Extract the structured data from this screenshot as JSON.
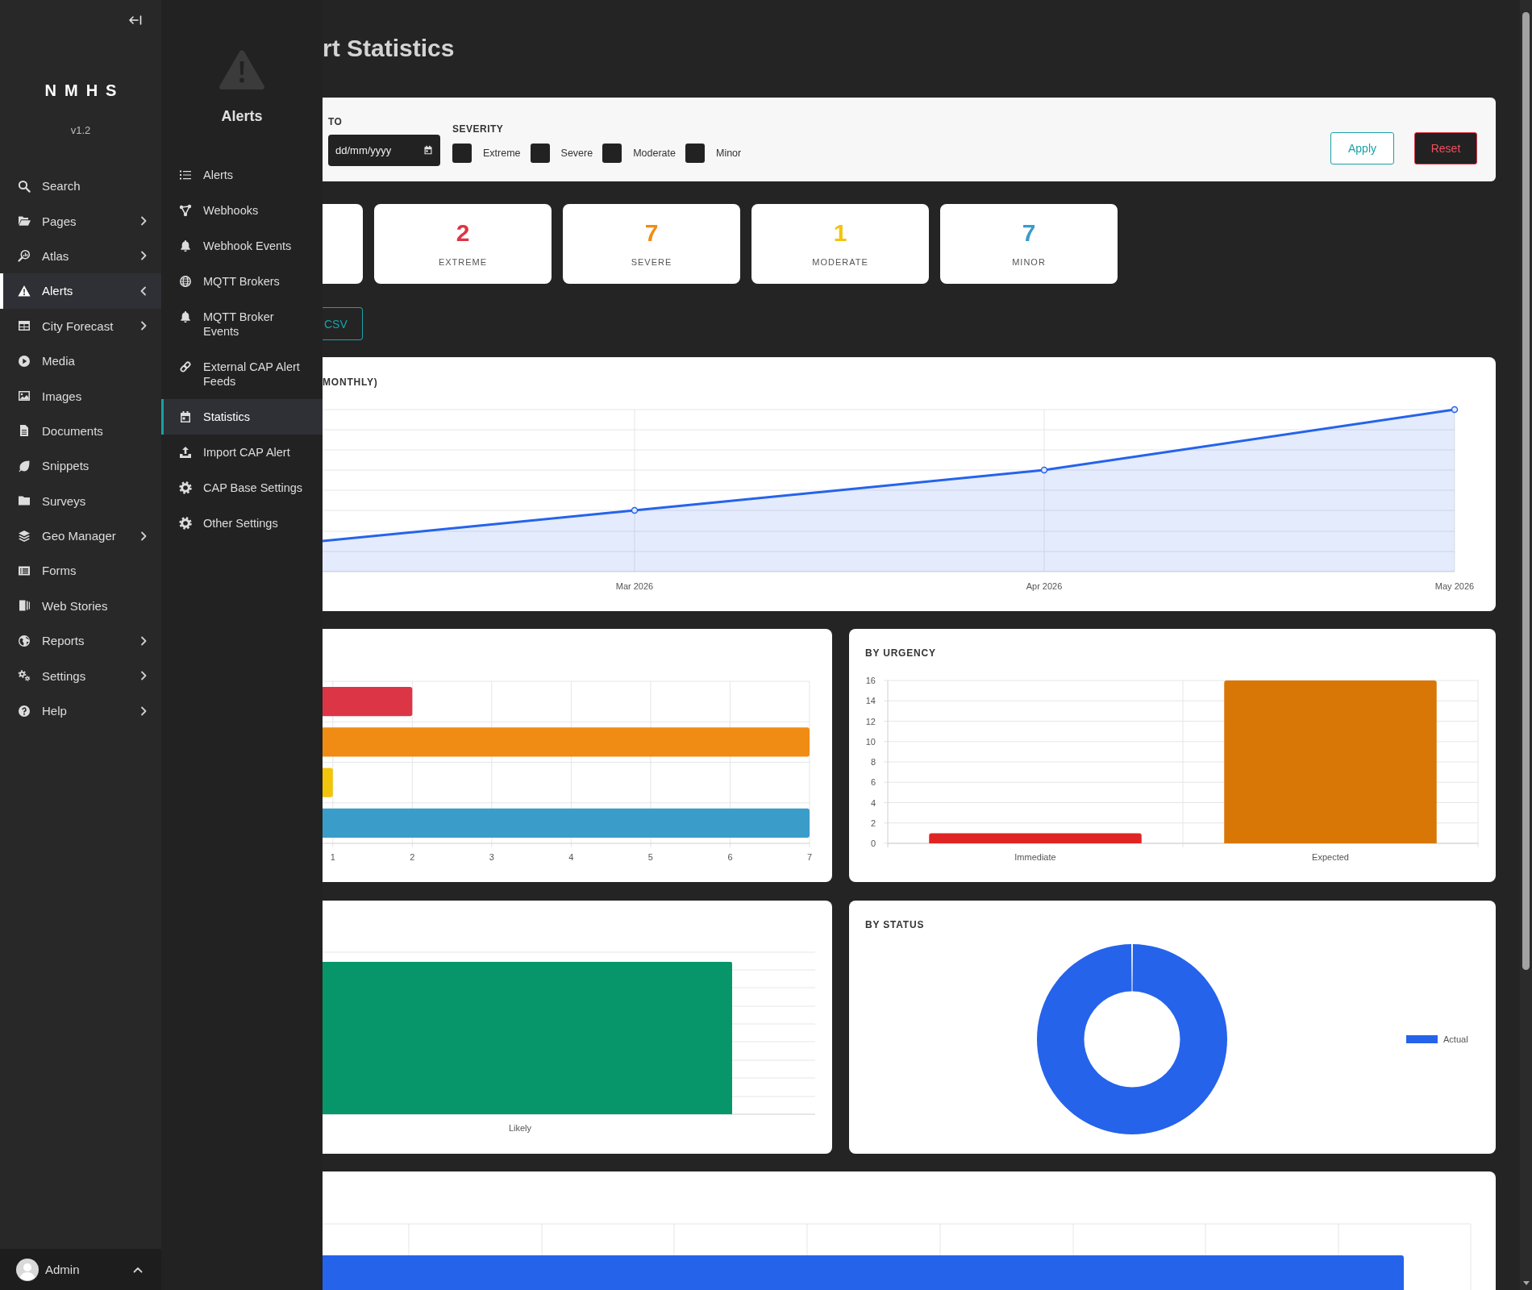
{
  "sidebar": {
    "brand": "NMHS",
    "version": "v1.2",
    "items": [
      {
        "label": "Search",
        "kind": "link",
        "selected": false
      },
      {
        "label": "Pages",
        "kind": "group",
        "expanded": false,
        "selected": false
      },
      {
        "label": "Atlas",
        "kind": "group",
        "expanded": false,
        "selected": false
      },
      {
        "label": "Alerts",
        "kind": "group",
        "expanded": true,
        "selected": true
      },
      {
        "label": "City Forecast",
        "kind": "group",
        "expanded": false,
        "selected": false
      },
      {
        "label": "Media",
        "kind": "link",
        "selected": false
      },
      {
        "label": "Images",
        "kind": "link",
        "selected": false
      },
      {
        "label": "Documents",
        "kind": "link",
        "selected": false
      },
      {
        "label": "Snippets",
        "kind": "link",
        "selected": false
      },
      {
        "label": "Surveys",
        "kind": "link",
        "selected": false
      },
      {
        "label": "Geo Manager",
        "kind": "group",
        "expanded": false,
        "selected": false
      },
      {
        "label": "Forms",
        "kind": "link",
        "selected": false
      },
      {
        "label": "Web Stories",
        "kind": "link",
        "selected": false
      },
      {
        "label": "Reports",
        "kind": "group",
        "expanded": false,
        "selected": false
      },
      {
        "label": "Settings",
        "kind": "group",
        "expanded": false,
        "selected": false
      },
      {
        "label": "Help",
        "kind": "group",
        "expanded": false,
        "selected": false
      }
    ],
    "user": {
      "name": "Admin"
    }
  },
  "submenu": {
    "title": "Alerts",
    "items": [
      {
        "label": "Alerts",
        "selected": false
      },
      {
        "label": "Webhooks",
        "selected": false
      },
      {
        "label": "Webhook Events",
        "selected": false
      },
      {
        "label": "MQTT Brokers",
        "selected": false
      },
      {
        "label": "MQTT Broker Events",
        "selected": false
      },
      {
        "label": "External CAP Alert Feeds",
        "selected": false
      },
      {
        "label": "Statistics",
        "selected": true
      },
      {
        "label": "Import CAP Alert",
        "selected": false
      },
      {
        "label": "CAP Base Settings",
        "selected": false
      },
      {
        "label": "Other Settings",
        "selected": false
      }
    ]
  },
  "page_title": "rt Statistics",
  "filters": {
    "to_label": "TO",
    "to_date": {
      "placeholder": "dd/mm/yyyy"
    },
    "severity_label": "SEVERITY",
    "severity_options": [
      {
        "label": "Extreme",
        "checked": false
      },
      {
        "label": "Severe",
        "checked": false
      },
      {
        "label": "Moderate",
        "checked": false
      },
      {
        "label": "Minor",
        "checked": false
      }
    ],
    "buttons": [
      {
        "label": "Apply",
        "kind": "apply"
      },
      {
        "label": "Reset",
        "kind": "reset"
      }
    ]
  },
  "summary_cards": [
    {
      "value": "2",
      "label": "EXTREME",
      "color": "#dc3545"
    },
    {
      "value": "7",
      "label": "SEVERE",
      "color": "#f08c14"
    },
    {
      "value": "1",
      "label": "MODERATE",
      "color": "#f2c40c"
    },
    {
      "value": "7",
      "label": "MINOR",
      "color": "#3a9cc9"
    }
  ],
  "export_button": {
    "label": "CSV"
  },
  "trend_chart": {
    "title": "MONTHLY)",
    "x_labels": [
      "Mar 2026",
      "Apr 2026",
      "May 2026"
    ]
  },
  "severity_chart": {
    "chart_data": {
      "type": "bar",
      "orientation": "horizontal",
      "values": [
        2,
        7,
        1,
        7
      ],
      "colors": [
        "#dc3545",
        "#f08c14",
        "#f2c40c",
        "#3a9cc9"
      ],
      "xlim": [
        0.87,
        7
      ],
      "xticks": [
        1,
        2,
        3,
        4,
        5,
        6,
        7
      ],
      "grid": true
    }
  },
  "urgency_chart": {
    "chart_data": {
      "type": "bar",
      "title": "BY URGENCY",
      "categories": [
        "Immediate",
        "Expected"
      ],
      "values": [
        1,
        16
      ],
      "colors": [
        "#e02424",
        "#d97706"
      ],
      "ylim": [
        0,
        16
      ],
      "yticks": [
        0,
        2,
        4,
        6,
        8,
        10,
        12,
        14,
        16
      ],
      "grid": true
    }
  },
  "certainty_chart": {
    "x_labels": [
      "Likely"
    ]
  },
  "status_chart": {
    "title": "BY STATUS",
    "legend": [
      {
        "label": "Actual"
      }
    ]
  }
}
